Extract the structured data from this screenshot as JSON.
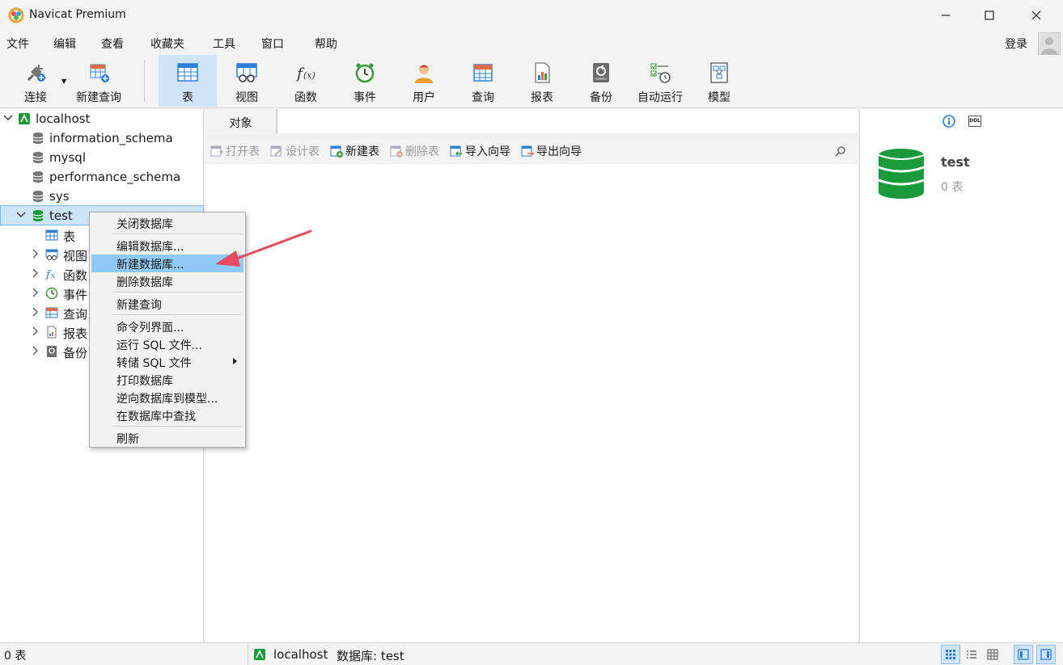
{
  "window": {
    "title": "Navicat Premium"
  },
  "menu": [
    "文件",
    "编辑",
    "查看",
    "收藏夹",
    "工具",
    "窗口",
    "帮助"
  ],
  "account": {
    "login_label": "登录"
  },
  "toolbar": {
    "connect": "连接",
    "new_query": "新建查询",
    "items": [
      "表",
      "视图",
      "函数",
      "事件",
      "用户",
      "查询",
      "报表",
      "备份",
      "自动运行",
      "模型"
    ]
  },
  "tree": {
    "connection": "localhost",
    "databases": [
      "information_schema",
      "mysql",
      "performance_schema",
      "sys",
      "test"
    ],
    "children": [
      "表",
      "视图",
      "函数",
      "事件",
      "查询",
      "报表",
      "备份"
    ]
  },
  "tabs": {
    "objects": "对象"
  },
  "object_toolbar": {
    "open_table": "打开表",
    "design_table": "设计表",
    "new_table": "新建表",
    "delete_table": "删除表",
    "import_wizard": "导入向导",
    "export_wizard": "导出向导"
  },
  "info": {
    "name": "test",
    "count": "0 表",
    "ddl": "DDL"
  },
  "status": {
    "left": "0 表",
    "connection": "localhost",
    "database": "数据库: test"
  },
  "context_menu": {
    "items": [
      "关闭数据库",
      "编辑数据库...",
      "新建数据库...",
      "删除数据库",
      "新建查询",
      "命令列界面...",
      "运行 SQL 文件...",
      "转储 SQL 文件",
      "打印数据库",
      "逆向数据库到模型...",
      "在数据库中查找",
      "刷新"
    ],
    "highlighted_index": 2
  },
  "colors": {
    "accent": "#cfe4f7",
    "menu_highlight": "#91c9f7",
    "db_green": "#1a9a3a",
    "annotation": "#e84a5f"
  }
}
